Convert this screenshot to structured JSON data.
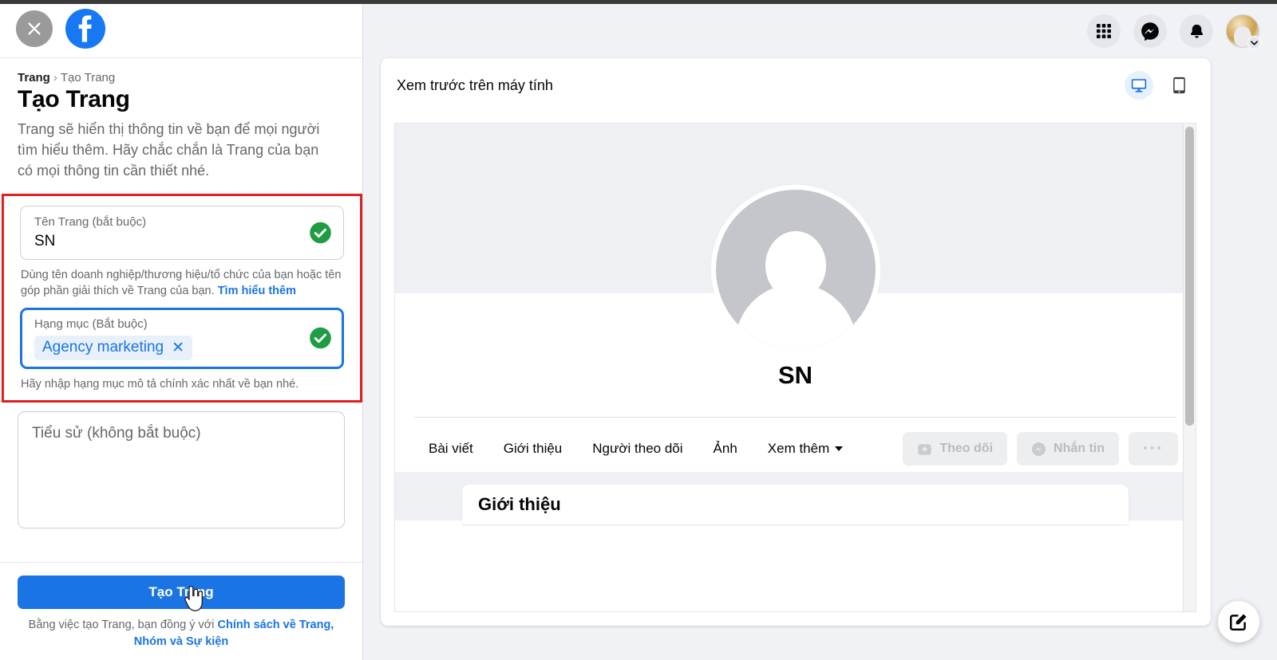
{
  "window": {
    "close_label": "×"
  },
  "brand": {
    "logo_name": "facebook-logo",
    "logo_color": "#1877f2"
  },
  "left_panel": {
    "breadcrumb": {
      "parent": "Trang",
      "separator": "›",
      "current": "Tạo Trang"
    },
    "title": "Tạo Trang",
    "description": "Trang sẽ hiển thị thông tin về bạn để mọi người tìm hiểu thêm. Hãy chắc chắn là Trang của bạn có mọi thông tin cần thiết nhé.",
    "fields": {
      "page_name": {
        "label": "Tên Trang (bắt buộc)",
        "value": "SN",
        "valid": true,
        "helper": "Dùng tên doanh nghiệp/thương hiệu/tổ chức của bạn hoặc tên góp phần giải thích về Trang của bạn.",
        "helper_link": "Tìm hiểu thêm"
      },
      "category": {
        "label": "Hạng mục (Bắt buộc)",
        "chip": "Agency marketing",
        "chip_remove": "✕",
        "valid": true,
        "helper": "Hãy nhập hạng mục mô tả chính xác nhất về bạn nhé."
      },
      "bio": {
        "placeholder": "Tiểu sử (không bắt buộc)",
        "value": ""
      }
    },
    "submit_label": "Tạo Trang",
    "terms_prefix": "Bằng việc tạo Trang, bạn đồng ý với ",
    "terms_link": "Chính sách về Trang, Nhóm và Sự kiện",
    "accent_color": "#1b74e4",
    "highlight_color": "#e02020"
  },
  "topbar": {
    "icons": [
      {
        "name": "grid-menu-icon",
        "label": "Menu"
      },
      {
        "name": "messenger-icon",
        "label": "Messenger"
      },
      {
        "name": "bell-icon",
        "label": "Thông báo"
      }
    ],
    "avatar_name": "user-avatar",
    "avatar_chevron": "chevron-down-icon"
  },
  "preview": {
    "title": "Xem trước trên máy tính",
    "device_desktop": "desktop-icon",
    "device_mobile": "mobile-icon",
    "active_device": "desktop",
    "page": {
      "name": "SN",
      "tabs": [
        {
          "label": "Bài viết",
          "has_caret": false
        },
        {
          "label": "Giới thiệu",
          "has_caret": false
        },
        {
          "label": "Người theo dõi",
          "has_caret": false
        },
        {
          "label": "Ảnh",
          "has_caret": false
        },
        {
          "label": "Xem thêm",
          "has_caret": true
        }
      ],
      "actions": [
        {
          "label": "Theo dõi",
          "icon": "follow-icon",
          "disabled": true
        },
        {
          "label": "Nhắn tin",
          "icon": "messenger-icon",
          "disabled": true
        },
        {
          "label": "···",
          "icon": "more-icon",
          "disabled": true
        }
      ],
      "about_card_title": "Giới thiệu"
    }
  },
  "fab": {
    "name": "compose-button",
    "icon": "compose-edit-icon"
  }
}
